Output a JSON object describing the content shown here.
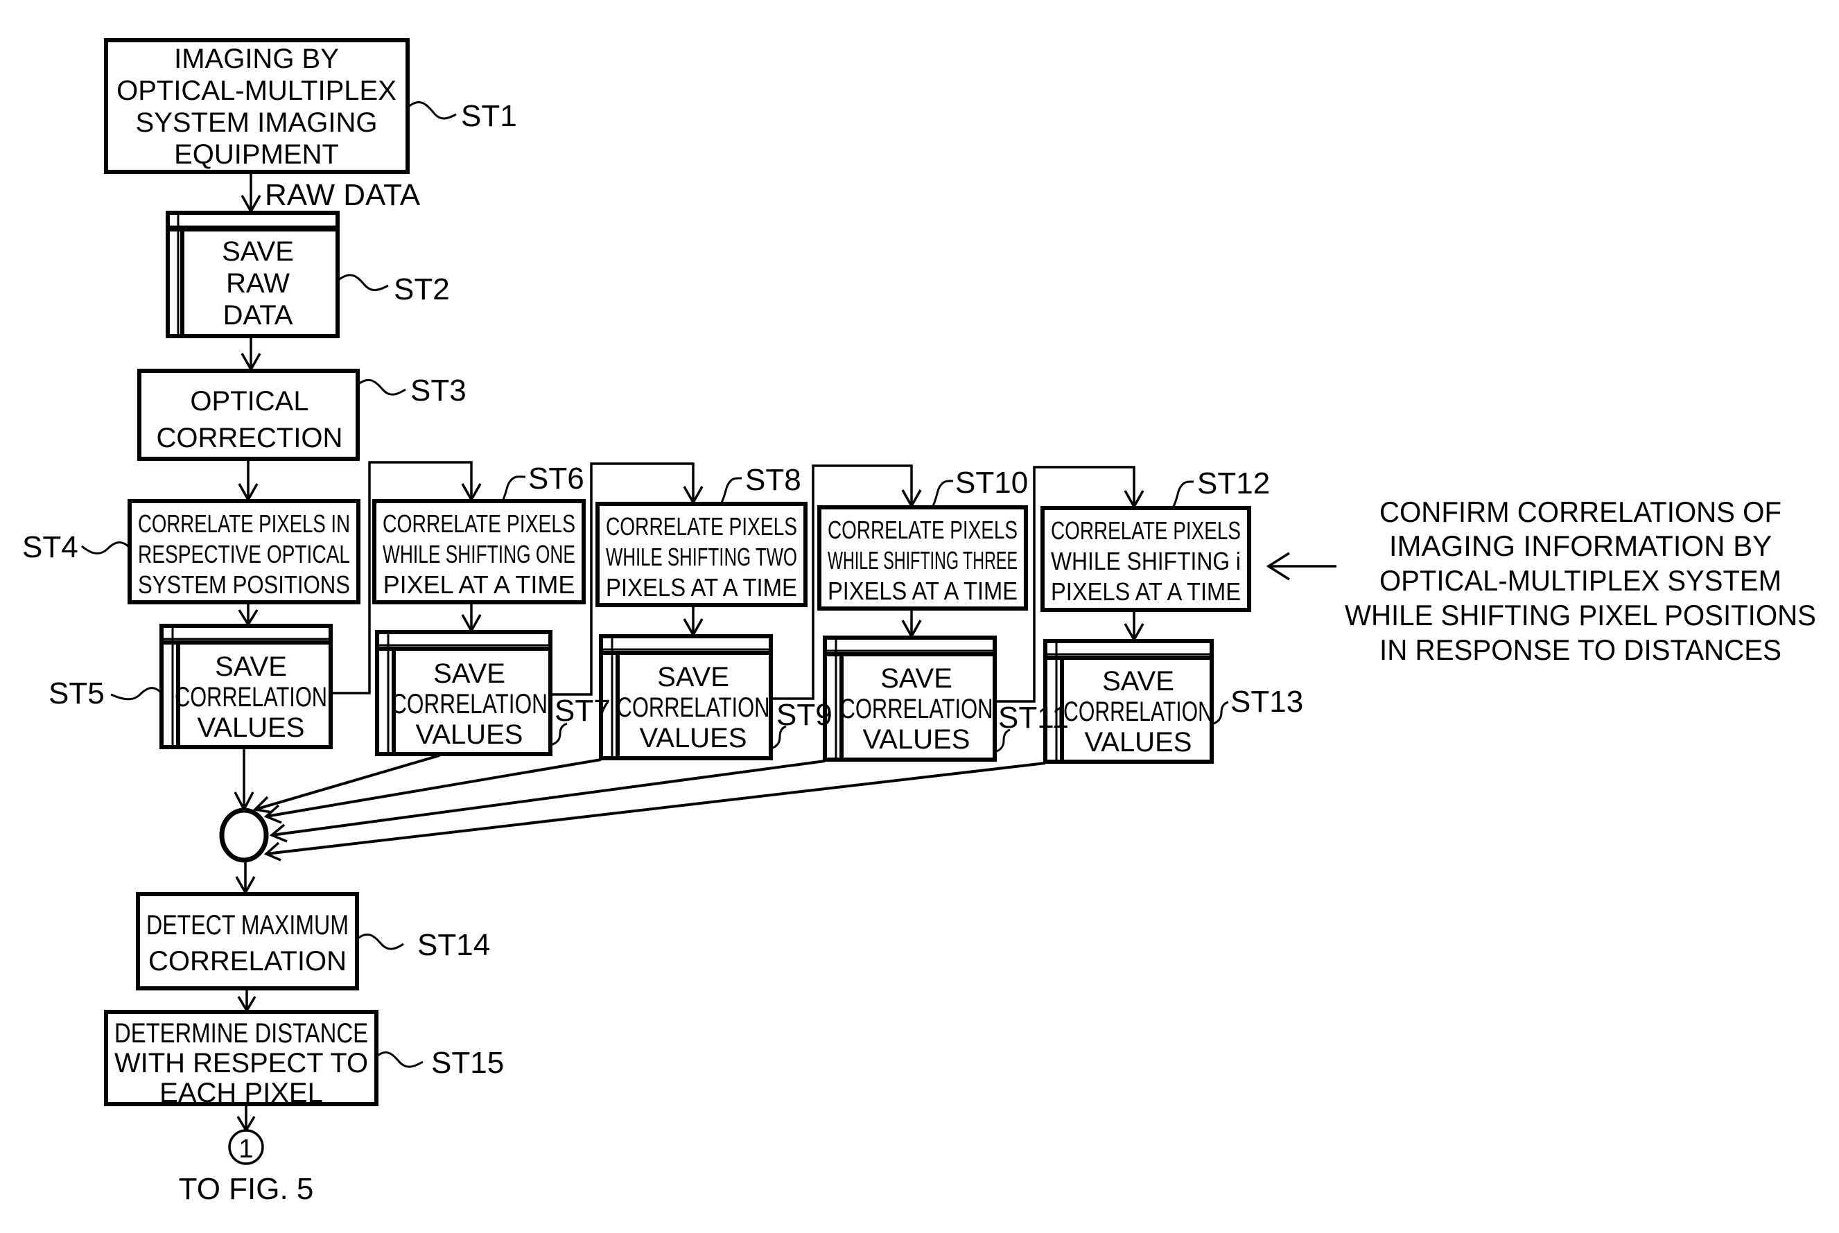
{
  "figure": {
    "steps": [
      {
        "id": "ST1",
        "kind": "process",
        "lines": [
          "IMAGING BY",
          "OPTICAL-MULTIPLEX",
          "SYSTEM IMAGING",
          "EQUIPMENT"
        ]
      },
      {
        "id": "ST2",
        "kind": "storage",
        "lines": [
          "SAVE",
          "RAW",
          "DATA"
        ]
      },
      {
        "id": "ST3",
        "kind": "process",
        "lines": [
          "OPTICAL",
          "CORRECTION"
        ]
      },
      {
        "id": "ST4",
        "kind": "process",
        "lines": [
          "CORRELATE PIXELS IN",
          "RESPECTIVE OPTICAL",
          "SYSTEM POSITIONS"
        ]
      },
      {
        "id": "ST5",
        "kind": "storage",
        "lines": [
          "SAVE",
          "CORRELATION",
          "VALUES"
        ]
      },
      {
        "id": "ST6",
        "kind": "process",
        "lines": [
          "CORRELATE PIXELS",
          "WHILE SHIFTING ONE",
          "PIXEL AT A TIME"
        ]
      },
      {
        "id": "ST7",
        "kind": "storage",
        "lines": [
          "SAVE",
          "CORRELATION",
          "VALUES"
        ]
      },
      {
        "id": "ST8",
        "kind": "process",
        "lines": [
          "CORRELATE PIXELS",
          "WHILE SHIFTING TWO",
          "PIXELS AT A TIME"
        ]
      },
      {
        "id": "ST9",
        "kind": "storage",
        "lines": [
          "SAVE",
          "CORRELATION",
          "VALUES"
        ]
      },
      {
        "id": "ST10",
        "kind": "process",
        "lines": [
          "CORRELATE PIXELS",
          "WHILE SHIFTING THREE",
          "PIXELS AT A TIME"
        ]
      },
      {
        "id": "ST11",
        "kind": "storage",
        "lines": [
          "SAVE",
          "CORRELATION",
          "VALUES"
        ]
      },
      {
        "id": "ST12",
        "kind": "process",
        "lines": [
          "CORRELATE PIXELS",
          "WHILE SHIFTING i",
          "PIXELS AT A TIME"
        ]
      },
      {
        "id": "ST13",
        "kind": "storage",
        "lines": [
          "SAVE",
          "CORRELATION",
          "VALUES"
        ]
      },
      {
        "id": "ST14",
        "kind": "process",
        "lines": [
          "DETECT MAXIMUM",
          "CORRELATION"
        ]
      },
      {
        "id": "ST15",
        "kind": "process",
        "lines": [
          "DETERMINE DISTANCE",
          "WITH RESPECT TO",
          "EACH PIXEL"
        ]
      }
    ],
    "edge_labels": {
      "st1_to_st2": "RAW DATA"
    },
    "connector": {
      "symbol": "1",
      "caption": "TO FIG. 5"
    },
    "annotation": {
      "lines": [
        "CONFIRM CORRELATIONS OF",
        "IMAGING INFORMATION BY",
        "OPTICAL-MULTIPLEX SYSTEM",
        "WHILE SHIFTING PIXEL POSITIONS",
        "IN RESPONSE TO DISTANCES"
      ],
      "points_to": "ST12"
    }
  }
}
